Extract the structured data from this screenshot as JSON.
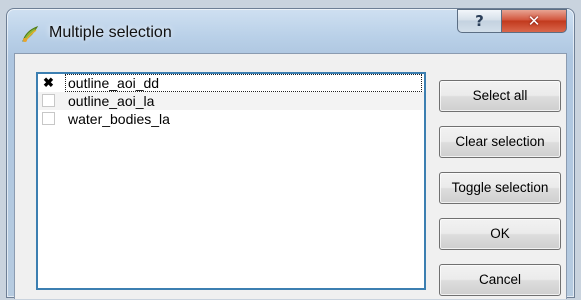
{
  "window": {
    "title": "Multiple selection",
    "help_symbol": "?",
    "close_symbol": "✕"
  },
  "list": {
    "items": [
      {
        "label": "outline_aoi_dd",
        "checked": true,
        "check_mark": "✖"
      },
      {
        "label": "outline_aoi_la",
        "checked": false,
        "check_mark": ""
      },
      {
        "label": "water_bodies_la",
        "checked": false,
        "check_mark": ""
      }
    ]
  },
  "buttons": {
    "select_all": "Select all",
    "clear_selection": "Clear selection",
    "toggle_selection": "Toggle selection",
    "ok": "OK",
    "cancel": "Cancel"
  },
  "colors": {
    "list_border": "#3c7fb1",
    "close_button": "#c23a1d"
  }
}
